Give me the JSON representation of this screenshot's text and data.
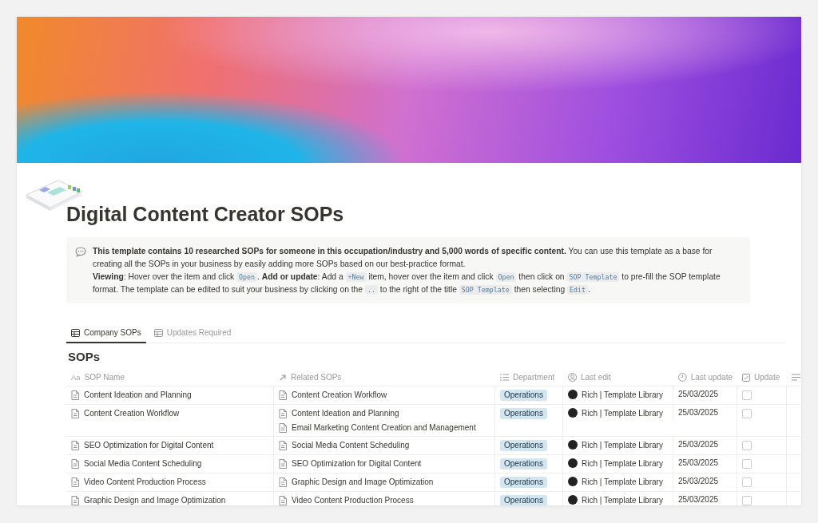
{
  "page": {
    "title": "Digital Content Creator SOPs"
  },
  "callout": {
    "paragraphs": [
      [
        {
          "kind": "bold",
          "text": "This template contains 10 researched SOPs for someone in this occupation/industry and 5,000 words of specific content."
        },
        {
          "kind": "plain",
          "text": " You can use this template as a base for creating all the SOPs in your business by easily adding more SOPs based on our best-practice format."
        }
      ],
      [
        {
          "kind": "bold",
          "text": "Viewing"
        },
        {
          "kind": "plain",
          "text": ": Hover over the item and click "
        },
        {
          "kind": "code",
          "text": "Open"
        },
        {
          "kind": "plain",
          "text": ". "
        },
        {
          "kind": "bold",
          "text": "Add or update"
        },
        {
          "kind": "plain",
          "text": ": Add a "
        },
        {
          "kind": "code",
          "text": "+New"
        },
        {
          "kind": "plain",
          "text": " item, hover over the item and click "
        },
        {
          "kind": "code",
          "text": "Open"
        },
        {
          "kind": "plain",
          "text": " then click on "
        },
        {
          "kind": "code",
          "text": "SOP Template"
        },
        {
          "kind": "plain",
          "text": " to pre-fill the SOP template format. The template can be edited to suit your business by clicking on the "
        },
        {
          "kind": "code",
          "text": ".."
        },
        {
          "kind": "plain",
          "text": " to the right of the title "
        },
        {
          "kind": "code",
          "text": "SOP Template"
        },
        {
          "kind": "plain",
          "text": " then selecting "
        },
        {
          "kind": "code",
          "text": "Edit"
        },
        {
          "kind": "plain",
          "text": "."
        }
      ]
    ]
  },
  "tabs": [
    {
      "label": "Company SOPs",
      "selected": true
    },
    {
      "label": "Updates Required",
      "selected": false
    }
  ],
  "table": {
    "title": "SOPs",
    "columns": [
      {
        "kind": "title",
        "glyph": "Aa",
        "label": "SOP Name"
      },
      {
        "kind": "relation",
        "label": "Related SOPs"
      },
      {
        "kind": "select",
        "label": "Department"
      },
      {
        "kind": "person",
        "label": "Last edit"
      },
      {
        "kind": "date",
        "label": "Last update"
      },
      {
        "kind": "checkbox",
        "label": "Update"
      },
      {
        "kind": "text"
      }
    ],
    "rows": [
      {
        "name": "Content Ideation and Planning",
        "related": [
          "Content Creation Workflow"
        ],
        "department": "Operations",
        "last_edit": "Rich | Template Library",
        "last_update": "25/03/2025",
        "update": false
      },
      {
        "name": "Content Creation Workflow",
        "related": [
          "Content Ideation and Planning",
          "Email Marketing Content Creation and Management"
        ],
        "department": "Operations",
        "last_edit": "Rich | Template Library",
        "last_update": "25/03/2025",
        "update": false
      },
      {
        "name": "SEO Optimization for Digital Content",
        "related": [
          "Social Media Content Scheduling"
        ],
        "department": "Operations",
        "last_edit": "Rich | Template Library",
        "last_update": "25/03/2025",
        "update": false
      },
      {
        "name": "Social Media Content Scheduling",
        "related": [
          "SEO Optimization for Digital Content"
        ],
        "department": "Operations",
        "last_edit": "Rich | Template Library",
        "last_update": "25/03/2025",
        "update": false
      },
      {
        "name": "Video Content Production Process",
        "related": [
          "Graphic Design and Image Optimization"
        ],
        "department": "Operations",
        "last_edit": "Rich | Template Library",
        "last_update": "25/03/2025",
        "update": false
      },
      {
        "name": "Graphic Design and Image Optimization",
        "related": [
          "Video Content Production Process"
        ],
        "department": "Operations",
        "last_edit": "Rich | Template Library",
        "last_update": "25/03/2025",
        "update": false
      }
    ]
  }
}
